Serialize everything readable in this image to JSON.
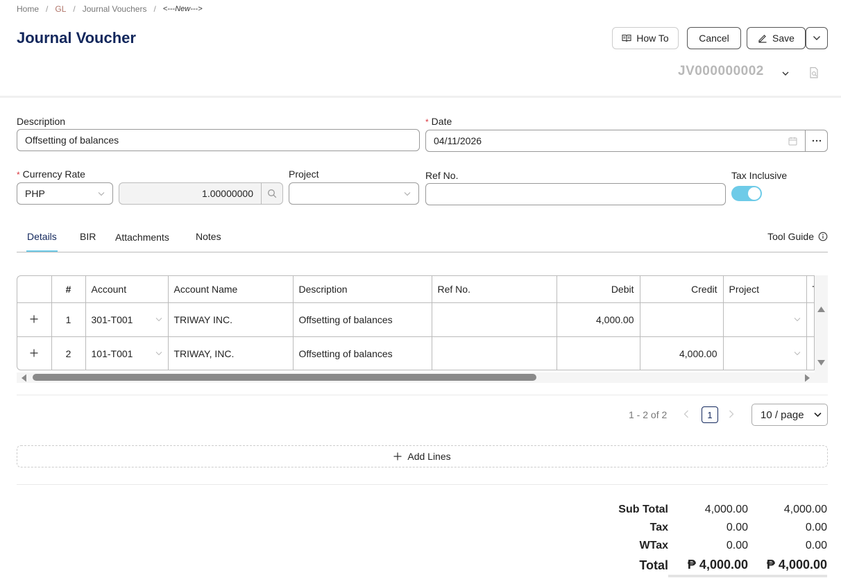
{
  "breadcrumb": {
    "home": "Home",
    "gl": "GL",
    "vouchers": "Journal Vouchers",
    "current": "<---New--->"
  },
  "header": {
    "title": "Journal Voucher",
    "how_to_label": "How To",
    "cancel_label": "Cancel",
    "save_label": "Save",
    "voucher_number": "JV000000002"
  },
  "form": {
    "description_label": "Description",
    "description_value": "Offsetting of balances",
    "date_label": "Date",
    "date_value": "04/11/2026",
    "currency_rate_label": "Currency Rate",
    "currency_value": "PHP",
    "rate_value": "1.00000000",
    "project_label": "Project",
    "project_value": "",
    "ref_no_label": "Ref No.",
    "ref_no_value": "",
    "tax_inclusive_label": "Tax Inclusive",
    "tax_inclusive_on": true
  },
  "tabs": {
    "items": [
      "Details",
      "BIR",
      "Attachments",
      "Notes"
    ],
    "active": "Details",
    "tool_guide_label": "Tool Guide"
  },
  "grid": {
    "columns": [
      "#",
      "Account",
      "Account Name",
      "Description",
      "Ref No.",
      "Debit",
      "Credit",
      "Project",
      "T"
    ],
    "rows": [
      {
        "no": "1",
        "account": "301-T001",
        "account_name": "TRIWAY INC.",
        "description": "Offsetting of balances",
        "ref_no": "",
        "debit": "4,000.00",
        "credit": "",
        "project": ""
      },
      {
        "no": "2",
        "account": "101-T001",
        "account_name": "TRIWAY, INC.",
        "description": "Offsetting of balances",
        "ref_no": "",
        "debit": "",
        "credit": "4,000.00",
        "project": ""
      }
    ]
  },
  "pagination": {
    "range": "1 - 2 of 2",
    "current_page": "1",
    "page_size": "10 / page"
  },
  "add_lines_label": "Add Lines",
  "totals": {
    "sub_total_label": "Sub Total",
    "sub_total_debit": "4,000.00",
    "sub_total_credit": "4,000.00",
    "tax_label": "Tax",
    "tax_debit": "0.00",
    "tax_credit": "0.00",
    "wtax_label": "WTax",
    "wtax_debit": "0.00",
    "wtax_credit": "0.00",
    "total_label": "Total",
    "total_debit": "₱ 4,000.00",
    "total_credit": "₱ 4,000.00"
  },
  "colors": {
    "brand": "#12275c",
    "accent": "#6ecbe8",
    "required": "#d9363e"
  }
}
